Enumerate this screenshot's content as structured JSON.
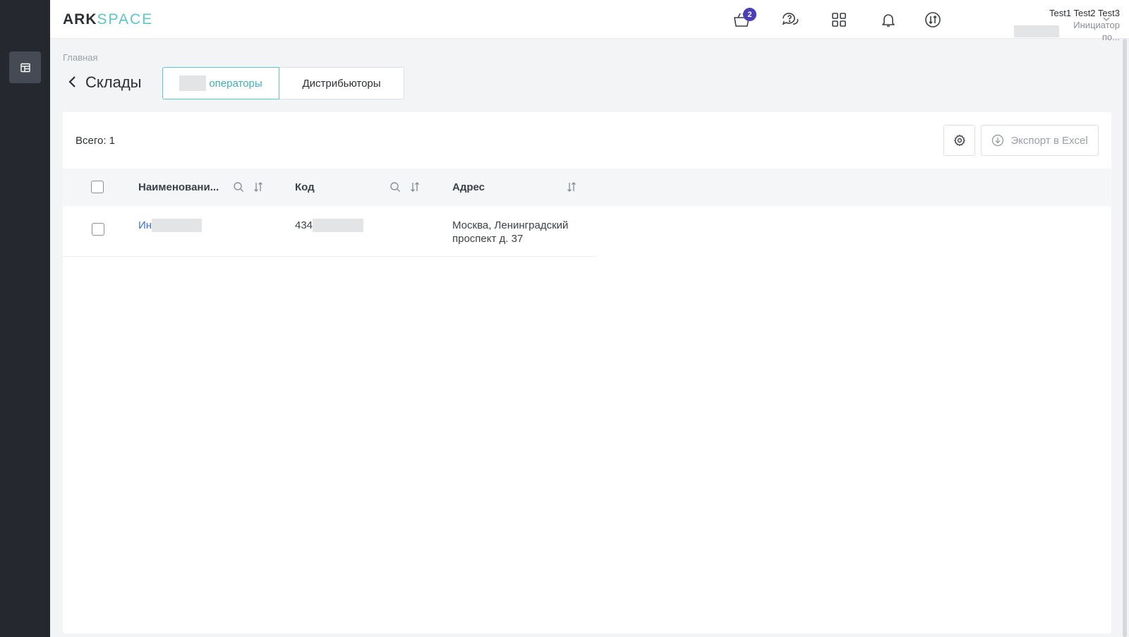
{
  "header": {
    "logo_primary": "ARK",
    "logo_secondary": "SPACE",
    "cart_badge": "2",
    "user": {
      "name": "Test1 Test2 Test3",
      "role": "Инициатор по..."
    }
  },
  "breadcrumb": "Главная",
  "page": {
    "title": "Склады"
  },
  "tabs": [
    {
      "label": "операторы",
      "active": true
    },
    {
      "label": "Дистрибьюторы",
      "active": false
    }
  ],
  "toolbar": {
    "total_label": "Всего: 1",
    "export_label": "Экспорт в Excel"
  },
  "table": {
    "columns": [
      {
        "label": "Наименовани..."
      },
      {
        "label": "Код"
      },
      {
        "label": "Адрес"
      }
    ],
    "rows": [
      {
        "name": "Ин",
        "code": "434",
        "address_line1": "Москва, Ленинградский",
        "address_line2": "проспект д. 37"
      }
    ]
  },
  "colors": {
    "accent": "#5bc6c9",
    "link": "#3b6fd6",
    "badge": "#4a3fb8",
    "sidebar": "#25282e"
  }
}
